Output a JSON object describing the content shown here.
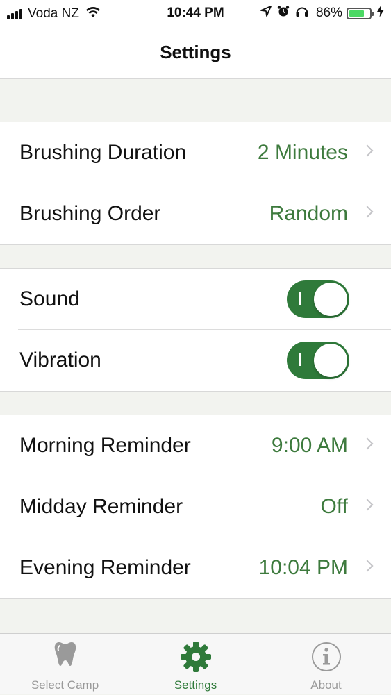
{
  "status_bar": {
    "carrier": "Voda NZ",
    "time": "10:44 PM",
    "battery_percent": "86%",
    "battery_level": 0.86,
    "icons": [
      "signal-icon",
      "wifi-icon",
      "location-icon",
      "alarm-icon",
      "headphones-icon",
      "battery-icon",
      "charging-icon"
    ]
  },
  "nav": {
    "title": "Settings"
  },
  "groups": {
    "brushing": {
      "duration": {
        "label": "Brushing Duration",
        "value": "2 Minutes"
      },
      "order": {
        "label": "Brushing Order",
        "value": "Random"
      }
    },
    "feedback": {
      "sound": {
        "label": "Sound",
        "on": true
      },
      "vibration": {
        "label": "Vibration",
        "on": true
      }
    },
    "reminders": {
      "morning": {
        "label": "Morning Reminder",
        "value": "9:00 AM"
      },
      "midday": {
        "label": "Midday Reminder",
        "value": "Off"
      },
      "evening": {
        "label": "Evening Reminder",
        "value": "10:04 PM"
      }
    }
  },
  "tabs": [
    {
      "label": "Select Camp",
      "icon": "tooth-icon",
      "active": false
    },
    {
      "label": "Settings",
      "icon": "gear-icon",
      "active": true
    },
    {
      "label": "About",
      "icon": "info-icon",
      "active": false
    }
  ],
  "colors": {
    "accent": "#2f7a3a",
    "value_text": "#3d7a3d",
    "background": "#f2f3ef",
    "inactive_tab": "#999999",
    "battery": "#4cd964"
  }
}
